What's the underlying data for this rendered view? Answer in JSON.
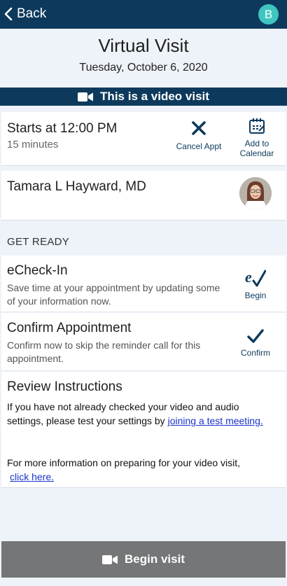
{
  "nav": {
    "back_label": "Back",
    "avatar_initial": "B"
  },
  "header": {
    "title": "Virtual Visit",
    "date": "Tuesday, October 6, 2020"
  },
  "banner": {
    "text": "This is a video visit"
  },
  "appointment": {
    "start": "Starts at 12:00 PM",
    "duration": "15 minutes",
    "cancel_label": "Cancel Appt",
    "add_calendar_label_1": "Add to",
    "add_calendar_label_2": "Calendar"
  },
  "provider": {
    "name": "Tamara L Hayward, MD"
  },
  "get_ready": {
    "label": "GET READY"
  },
  "echeckin": {
    "title": "eCheck-In",
    "desc": "Save time at your appointment by updating some of your information now.",
    "action": "Begin"
  },
  "confirm": {
    "title": "Confirm Appointment",
    "desc": "Confirm now to skip the reminder call for this appointment.",
    "action": "Confirm"
  },
  "review": {
    "title": "Review Instructions",
    "p1_text": "If you have not already checked your video and audio settings, please test your settings by ",
    "p1_link": "joining a test meeting.",
    "p2_text": "For more information on preparing for your video visit, ",
    "p2_link": "click here."
  },
  "footer": {
    "begin_label": "Begin visit"
  },
  "colors": {
    "navy": "#0d3a5c",
    "avatar": "#3ec6c0",
    "button_disabled": "#757677",
    "link": "#1a33cc"
  },
  "icons": [
    "chevron-left-icon",
    "video-camera-icon",
    "close-icon",
    "calendar-icon",
    "check-icon",
    "signature-check-icon"
  ]
}
